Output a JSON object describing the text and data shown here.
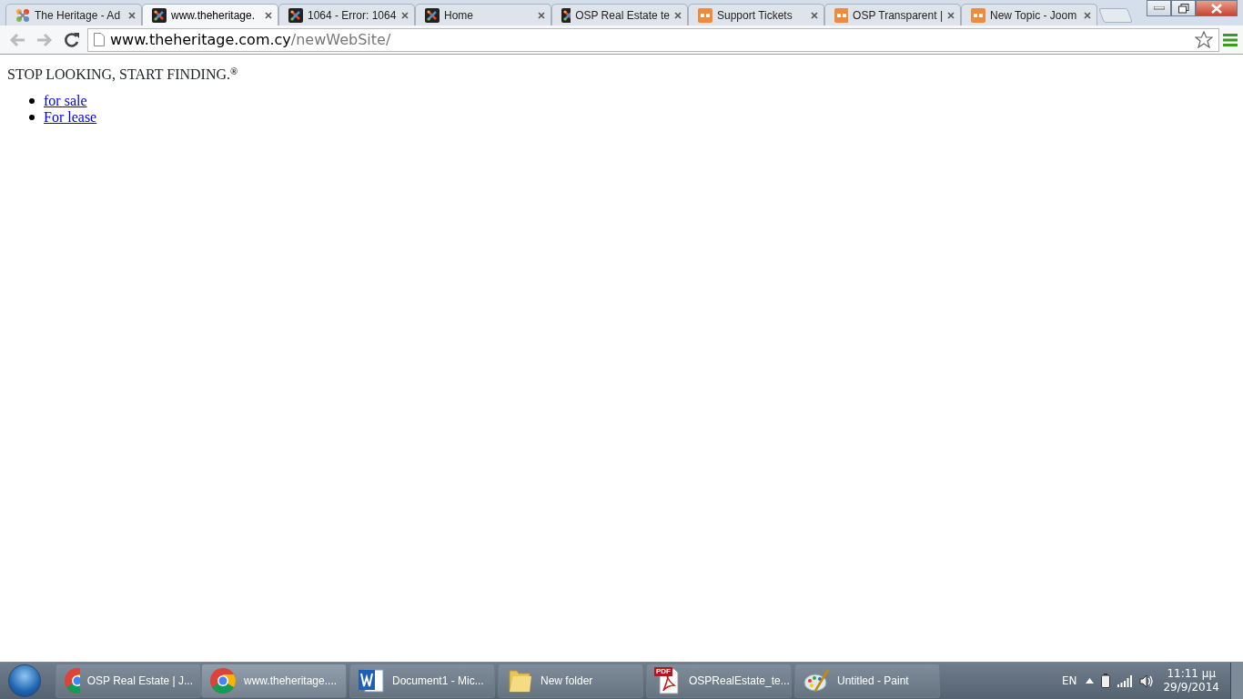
{
  "tabs": [
    {
      "title": "The Heritage - Ad",
      "kind": "joomla",
      "selected": false
    },
    {
      "title": "www.theheritage.",
      "kind": "joomla-dark",
      "selected": true
    },
    {
      "title": "1064 - Error: 1064",
      "kind": "joomla-dark",
      "selected": false
    },
    {
      "title": "Home",
      "kind": "joomla-dark",
      "selected": false
    },
    {
      "title": "OSP Real Estate te",
      "kind": "joomla-dark",
      "selected": false
    },
    {
      "title": "Support Tickets",
      "kind": "os",
      "selected": false
    },
    {
      "title": "OSP Transparent |",
      "kind": "os",
      "selected": false
    },
    {
      "title": "New Topic - Joom",
      "kind": "os",
      "selected": false
    }
  ],
  "address_bar": {
    "host": "www.theheritage.com.cy",
    "path": "/newWebSite/"
  },
  "page": {
    "heading": "STOP LOOKING, START FINDING.$^{®}$",
    "links": [
      "for sale",
      "For lease"
    ]
  },
  "taskbar": {
    "items": [
      {
        "label": "OSP Real Estate | J...",
        "kind": "chrome",
        "selected": false
      },
      {
        "label": "www.theheritage....",
        "kind": "chrome",
        "selected": true
      },
      {
        "label": "Document1 - Mic...",
        "kind": "word",
        "selected": false
      },
      {
        "label": "New folder",
        "kind": "folder",
        "selected": false
      },
      {
        "label": "OSPRealEstate_te...",
        "kind": "pdf",
        "icon_label": "PDF",
        "selected": false
      },
      {
        "label": "Untitled - Paint",
        "kind": "paint",
        "selected": false
      }
    ],
    "language": "EN",
    "time": "11:11 μμ",
    "date": "29/9/2014"
  }
}
